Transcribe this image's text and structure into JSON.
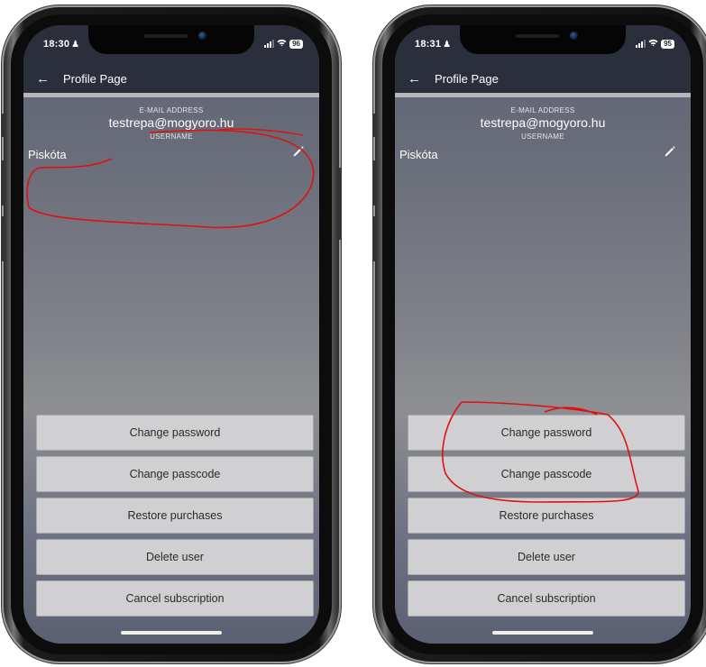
{
  "phones": [
    {
      "status": {
        "time": "18:30",
        "battery": "96"
      },
      "appbar": {
        "title": "Profile Page"
      },
      "profile": {
        "email_label": "E-MAIL ADDRESS",
        "email": "testrepa@mogyoro.hu",
        "username_label": "USERNAME",
        "username": "Piskóta"
      },
      "buttons": [
        "Change password",
        "Change passcode",
        "Restore purchases",
        "Delete user",
        "Cancel subscription"
      ]
    },
    {
      "status": {
        "time": "18:31",
        "battery": "95"
      },
      "appbar": {
        "title": "Profile Page"
      },
      "profile": {
        "email_label": "E-MAIL ADDRESS",
        "email": "testrepa@mogyoro.hu",
        "username_label": "USERNAME",
        "username": "Piskóta"
      },
      "buttons": [
        "Change password",
        "Change passcode",
        "Restore purchases",
        "Delete user",
        "Cancel subscription"
      ]
    }
  ],
  "colors": {
    "appbar": "#2b2f3c",
    "button": "#d0d0d2",
    "annotation": "#e01010"
  },
  "icons": {
    "back": "arrow-left-icon",
    "edit": "pencil-icon",
    "person": "person-icon",
    "wifi": "wifi-icon",
    "signal": "signal-icon",
    "battery": "battery-icon"
  }
}
